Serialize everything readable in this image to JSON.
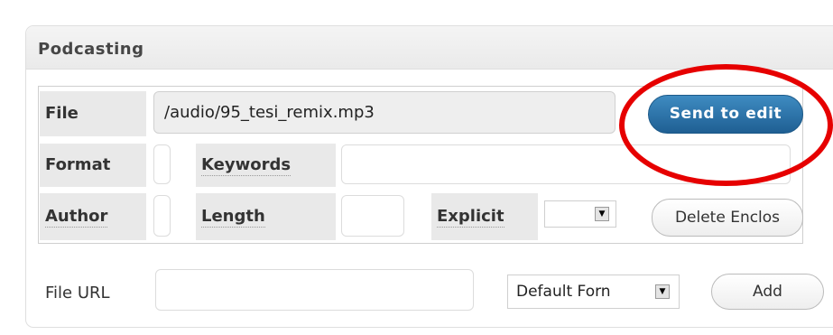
{
  "panel": {
    "title": "Podcasting"
  },
  "enclosure": {
    "file_label": "File",
    "file_value": "/audio/95_tesi_remix.mp3",
    "send_button_label": "Send to edit",
    "format_label": "Format",
    "format_value": "",
    "keywords_label": "Keywords",
    "keywords_value": "",
    "author_label": "Author",
    "author_value": "",
    "length_label": "Length",
    "length_value": "",
    "explicit_label": "Explicit",
    "explicit_value": "",
    "delete_button_label": "Delete Enclos"
  },
  "add_form": {
    "file_url_label": "File URL",
    "file_url_value": "",
    "format_select_value": "Default Forn",
    "add_button_label": "Add"
  },
  "annotation": {
    "ring_color": "#e60000"
  },
  "colors": {
    "send_button": "#2a6ea4",
    "label_background": "#e9e9e9"
  }
}
